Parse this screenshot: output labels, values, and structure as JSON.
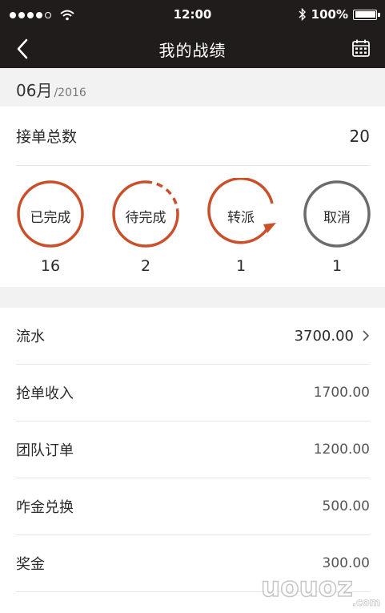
{
  "status_bar": {
    "time": "12:00",
    "battery": "100%"
  },
  "nav": {
    "title": "我的战绩",
    "back_icon": "back-chevron-icon",
    "calendar_icon": "calendar-icon"
  },
  "period": {
    "month": "06月",
    "year": "/2016"
  },
  "summary": {
    "label": "接单总数",
    "value": "20"
  },
  "statuses": [
    {
      "label": "已完成",
      "count": "16",
      "style": "solid",
      "color": "#c9502a"
    },
    {
      "label": "待完成",
      "count": "2",
      "style": "dashed",
      "color": "#c9502a"
    },
    {
      "label": "转派",
      "count": "1",
      "style": "arrow",
      "color": "#c9502a"
    },
    {
      "label": "取消",
      "count": "1",
      "style": "solid",
      "color": "#6b6b6b"
    }
  ],
  "rows": [
    {
      "label": "流水",
      "value": "3700.00"
    },
    {
      "label": "抢单收入",
      "value": "1700.00"
    },
    {
      "label": "团队订单",
      "value": "1200.00"
    },
    {
      "label": "咋金兑换",
      "value": "500.00"
    },
    {
      "label": "奖金",
      "value": "300.00"
    }
  ],
  "watermark": {
    "text": "uouoz",
    "suffix": ".com"
  },
  "colors": {
    "accent": "#c9502a",
    "header_bg": "#1f1c1b"
  }
}
